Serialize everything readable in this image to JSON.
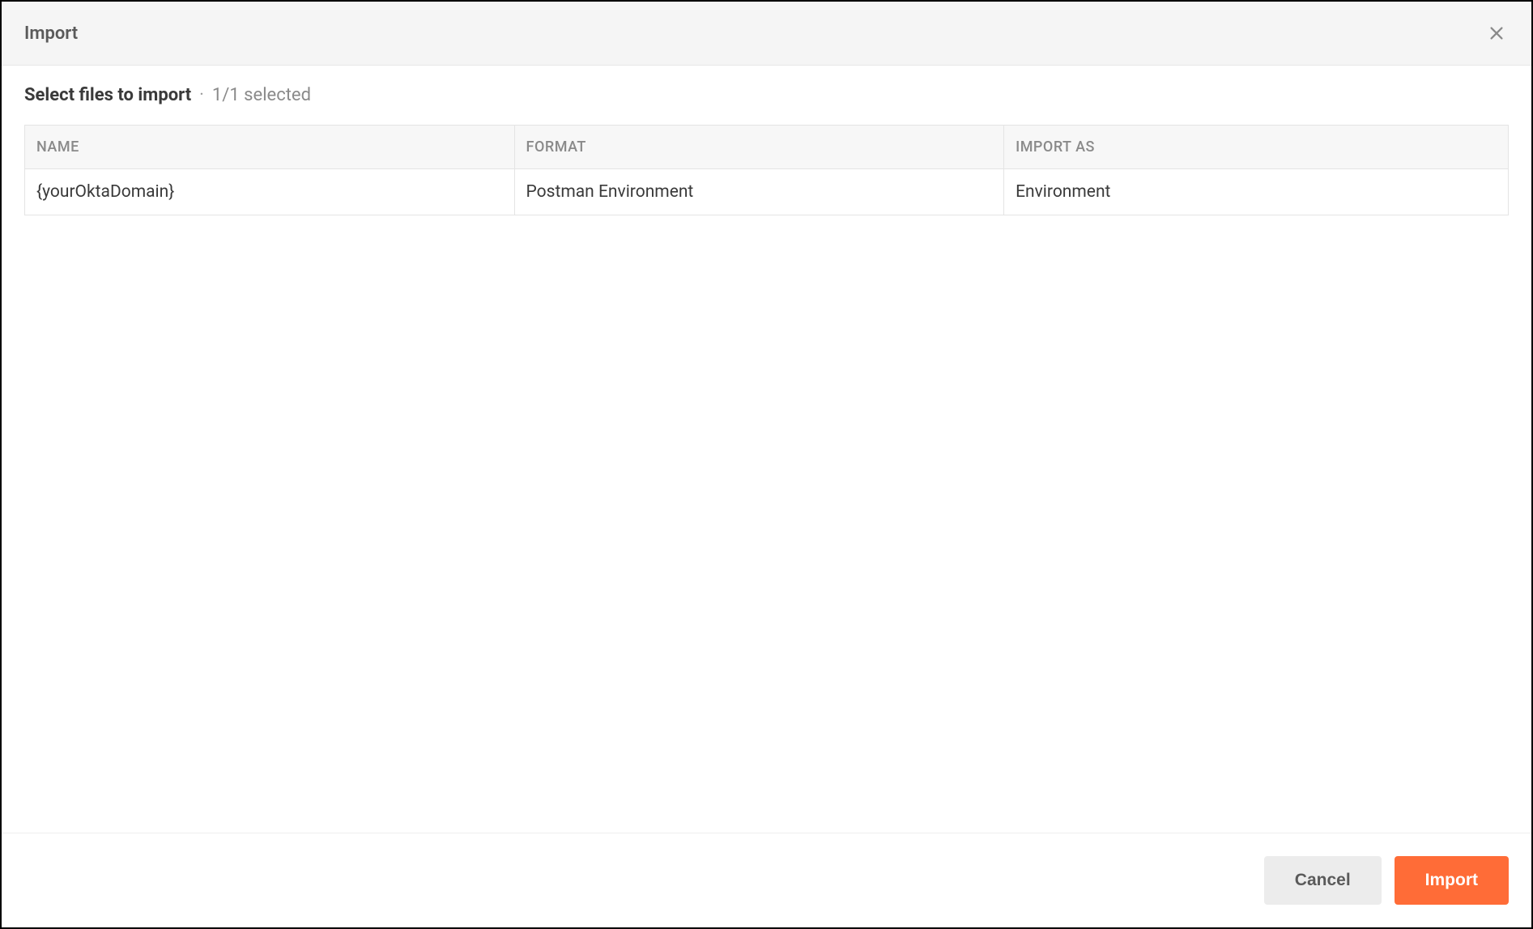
{
  "modal": {
    "title": "Import",
    "subtitle": "Select files to import",
    "separator": "·",
    "selection_count": "1/1 selected"
  },
  "table": {
    "headers": {
      "name": "NAME",
      "format": "FORMAT",
      "import_as": "IMPORT AS"
    },
    "rows": [
      {
        "name": "{yourOktaDomain}",
        "format": "Postman Environment",
        "import_as": "Environment"
      }
    ]
  },
  "footer": {
    "cancel_label": "Cancel",
    "import_label": "Import"
  }
}
